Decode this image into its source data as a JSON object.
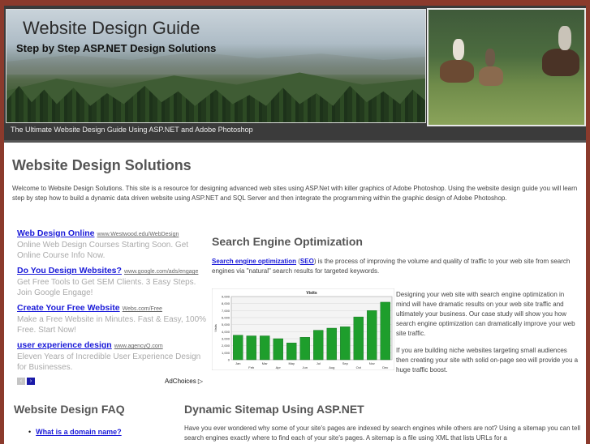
{
  "header": {
    "site_title": "Website Design Guide",
    "site_subtitle": "Step by Step ASP.NET Design Solutions",
    "tagline": "The Ultimate Website Design Guide Using ASP.NET and Adobe Photoshop"
  },
  "main": {
    "page_title": "Website Design Solutions",
    "intro": "Welcome to Website Design Solutions. This site is a resource for designing advanced web sites using ASP.Net with killer graphics of Adobe Photoshop. Using the website design guide you will learn step by step how to build a dynamic data driven website using ASP.NET and SQL Server and then integrate the programming within the graphic design of Adobe Photoshop."
  },
  "ads": {
    "items": [
      {
        "title": "Web Design Online",
        "url": "www.Westwood.edu/WebDesign",
        "desc": "Online Web Design Courses Starting Soon. Get Online Course Info Now."
      },
      {
        "title": "Do You Design Websites?",
        "url": "www.google.com/ads/engage",
        "desc": "Get Free Tools to Get SEM Clients. 3 Easy Steps. Join Google Engage!"
      },
      {
        "title": "Create Your Free Website",
        "url": "Webs.com/Free",
        "desc": "Make a Free Website in Minutes. Fast & Easy, 100% Free. Start Now!"
      },
      {
        "title": "user experience design",
        "url": "www.agencyQ.com",
        "desc": "Eleven Years of Incredible User Experience Design for Businesses."
      }
    ],
    "prev_icon": "‹",
    "next_icon": "›",
    "adchoices_label": "AdChoices ▷"
  },
  "seo": {
    "heading": "Search Engine Optimization",
    "intro_link": "Search engine optimization",
    "intro_paren_open": " (",
    "intro_abbr": "SEO",
    "intro_rest": ") is the process of improving the volume and quality of traffic to your web site from search engines via \"natural\" search results for targeted keywords.",
    "p1": "Designing your web site with search engine optimization in mind will have dramatic results on your web site traffic and ultimately your business. Our case study will show you how search engine optimization can dramatically improve your web site traffic.",
    "p2": "If you are building niche websites targeting small audiences then creating your site with solid on-page seo will provide you a huge traffic boost."
  },
  "chart_data": {
    "type": "bar",
    "title": "Visits",
    "ylabel": "Visits",
    "categories": [
      "Jan",
      "Feb",
      "Mar",
      "Apr",
      "May",
      "Jun",
      "Jul",
      "Aug",
      "Sep",
      "Oct",
      "Nov",
      "Dec"
    ],
    "values": [
      3500,
      3400,
      3400,
      3000,
      2400,
      3200,
      4200,
      4500,
      4700,
      6100,
      7000,
      8200
    ],
    "ylim": [
      0,
      9000
    ],
    "yticks": [
      "0",
      "1,000",
      "2,000",
      "3,000",
      "4,000",
      "5,000",
      "6,000",
      "7,000",
      "8,000",
      "9,000"
    ],
    "xticks": [
      "Jan",
      "Feb",
      "Mar",
      "Apr",
      "May",
      "Jun",
      "Jul",
      "Aug",
      "Sep",
      "Oct",
      "Nov",
      "Dec"
    ],
    "bar_color": "#1e9e2c",
    "grid": true
  },
  "faq": {
    "heading": "Website Design FAQ",
    "items": [
      {
        "label": "What is a domain name?"
      }
    ]
  },
  "sitemap": {
    "heading": "Dynamic Sitemap Using ASP.NET",
    "text": "Have you ever wondered why some of your site's pages are indexed by search engines while others are not? Using a sitemap you can tell search engines exactly where to find each of your site's pages. A sitemap is a file using XML that lists URLs for a"
  },
  "colors": {
    "page_background": "#8b3a2c",
    "header_background": "#3b3b3b",
    "link": "#1a1ad8",
    "heading": "#555555"
  }
}
